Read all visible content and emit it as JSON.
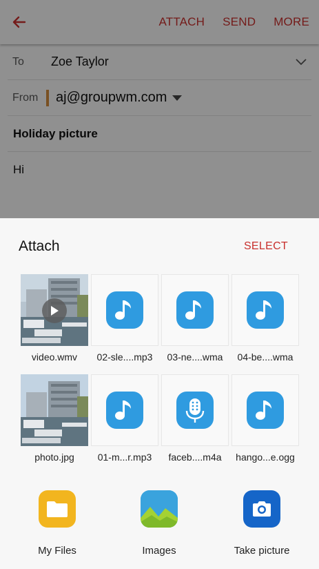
{
  "appbar": {
    "back_icon": "arrow-back-icon",
    "attach": "ATTACH",
    "send": "SEND",
    "more": "MORE",
    "accent": "#c8302d"
  },
  "compose": {
    "to_label": "To",
    "to_value": "Zoe Taylor",
    "from_label": "From",
    "from_value": "aj@groupwm.com",
    "subject": "Holiday picture",
    "body": "Hi"
  },
  "sheet": {
    "title": "Attach",
    "select": "SELECT",
    "files": [
      {
        "name": "video.wmv",
        "kind": "video",
        "icon": "video-thumbnail"
      },
      {
        "name": "02-sle....mp3",
        "kind": "audio",
        "icon": "music-note-icon"
      },
      {
        "name": "03-ne....wma",
        "kind": "audio",
        "icon": "music-note-icon"
      },
      {
        "name": "04-be....wma",
        "kind": "audio",
        "icon": "music-note-icon"
      },
      {
        "name": "photo.jpg",
        "kind": "image",
        "icon": "photo-thumbnail"
      },
      {
        "name": "01-m...r.mp3",
        "kind": "audio",
        "icon": "music-note-icon"
      },
      {
        "name": "faceb....m4a",
        "kind": "voice",
        "icon": "microphone-icon"
      },
      {
        "name": "hango...e.ogg",
        "kind": "audio",
        "icon": "music-note-icon"
      }
    ],
    "apps": [
      {
        "label": "My Files",
        "icon": "folder-icon",
        "color": "#f2b51f"
      },
      {
        "label": "Images",
        "icon": "gallery-icon",
        "color": "#3aa3dd"
      },
      {
        "label": "Take picture",
        "icon": "camera-icon",
        "color": "#1565c8"
      }
    ]
  }
}
